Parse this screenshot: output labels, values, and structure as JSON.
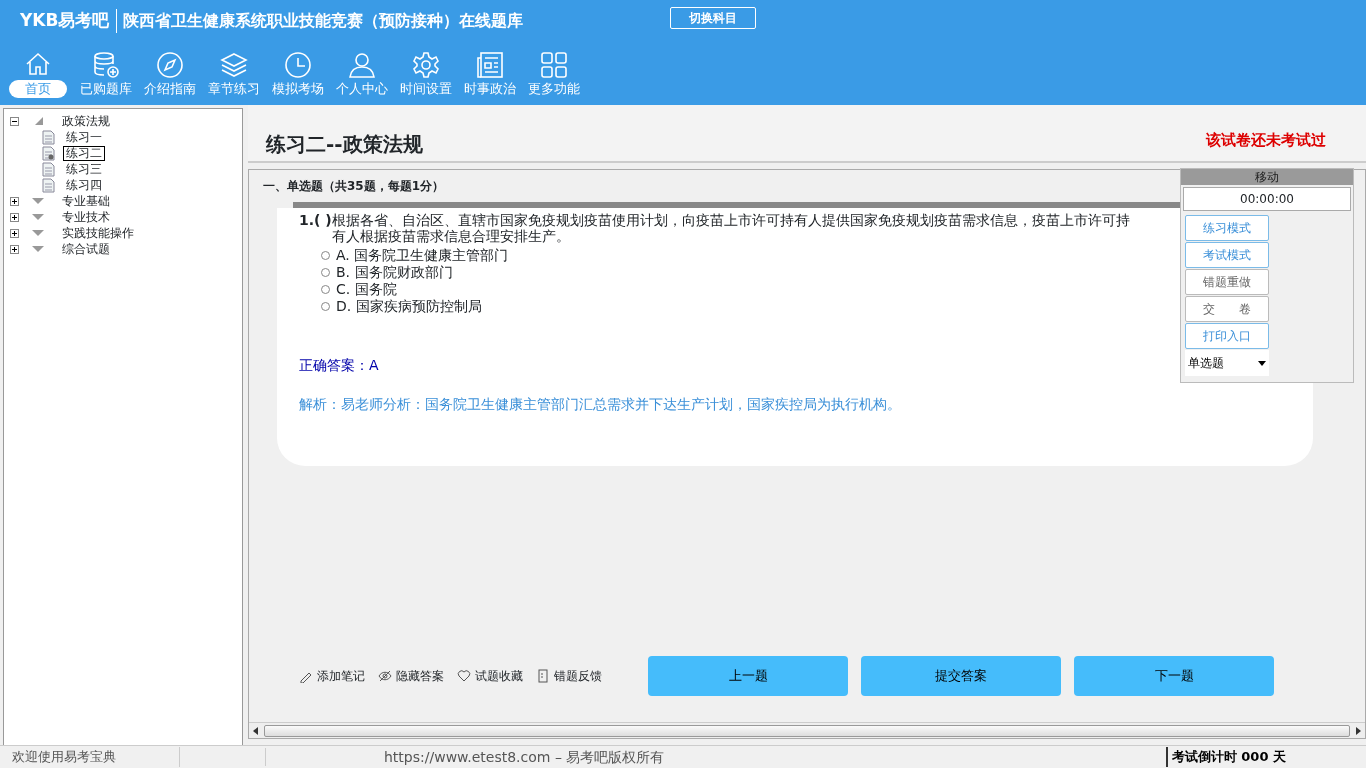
{
  "header": {
    "logo": "YKB易考吧",
    "title": "陕西省卫生健康系统职业技能竞赛（预防接种）在线题库",
    "switch_button": "切换科目"
  },
  "nav": [
    {
      "label": "首页",
      "selected": true
    },
    {
      "label": "已购题库",
      "selected": false
    },
    {
      "label": "介绍指南",
      "selected": false
    },
    {
      "label": "章节练习",
      "selected": false
    },
    {
      "label": "模拟考场",
      "selected": false
    },
    {
      "label": "个人中心",
      "selected": false
    },
    {
      "label": "时间设置",
      "selected": false
    },
    {
      "label": "时事政治",
      "selected": false
    },
    {
      "label": "更多功能",
      "selected": false
    }
  ],
  "tree": [
    {
      "label": "政策法规",
      "expanded": true,
      "children": [
        {
          "label": "练习一",
          "selected": false
        },
        {
          "label": "练习二",
          "selected": true
        },
        {
          "label": "练习三",
          "selected": false
        },
        {
          "label": "练习四",
          "selected": false
        }
      ]
    },
    {
      "label": "专业基础",
      "expanded": false
    },
    {
      "label": "专业技术",
      "expanded": false
    },
    {
      "label": "实践技能操作",
      "expanded": false
    },
    {
      "label": "综合试题",
      "expanded": false
    }
  ],
  "paper": {
    "title": "练习二--政策法规",
    "status": "该试卷还未考试过"
  },
  "section": "一、单选题（共35题，每题1分）",
  "question": {
    "number": "1.",
    "blank": "( )",
    "text": "根据各省、自治区、直辖市国家免疫规划疫苗使用计划，向疫苗上市许可持有人提供国家免疫规划疫苗需求信息，疫苗上市许可持有人根据疫苗需求信息合理安排生产。",
    "options": [
      {
        "letter": "A.",
        "text": "国务院卫生健康主管部门",
        "selected": false
      },
      {
        "letter": "B.",
        "text": "国务院财政部门",
        "selected": false
      },
      {
        "letter": "C.",
        "text": "国务院",
        "selected": false
      },
      {
        "letter": "D.",
        "text": "国家疾病预防控制局",
        "selected": false
      }
    ],
    "answer_label": "正确答案：",
    "answer": "A",
    "analysis": "解析：易老师分析：国务院卫生健康主管部门汇总需求并下达生产计划，国家疾控局为执行机构。"
  },
  "tools": [
    "添加笔记",
    "隐藏答案",
    "试题收藏",
    "错题反馈"
  ],
  "nav_buttons": [
    "上一题",
    "提交答案",
    "下一题"
  ],
  "panel": {
    "handle": "移动",
    "timer": "00:00:00",
    "buttons": [
      {
        "label": "练习模式",
        "disabled": false
      },
      {
        "label": "考试模式",
        "disabled": false
      },
      {
        "label": "错题重做",
        "disabled": true
      },
      {
        "label": "交　　卷",
        "disabled": true
      },
      {
        "label": "打印入口",
        "disabled": false
      }
    ],
    "select": "单选题"
  },
  "status_bar": {
    "welcome": "欢迎使用易考宝典",
    "copyright": "https://www.etest8.com – 易考吧版权所有",
    "countdown": "考试倒计时 000 天"
  }
}
